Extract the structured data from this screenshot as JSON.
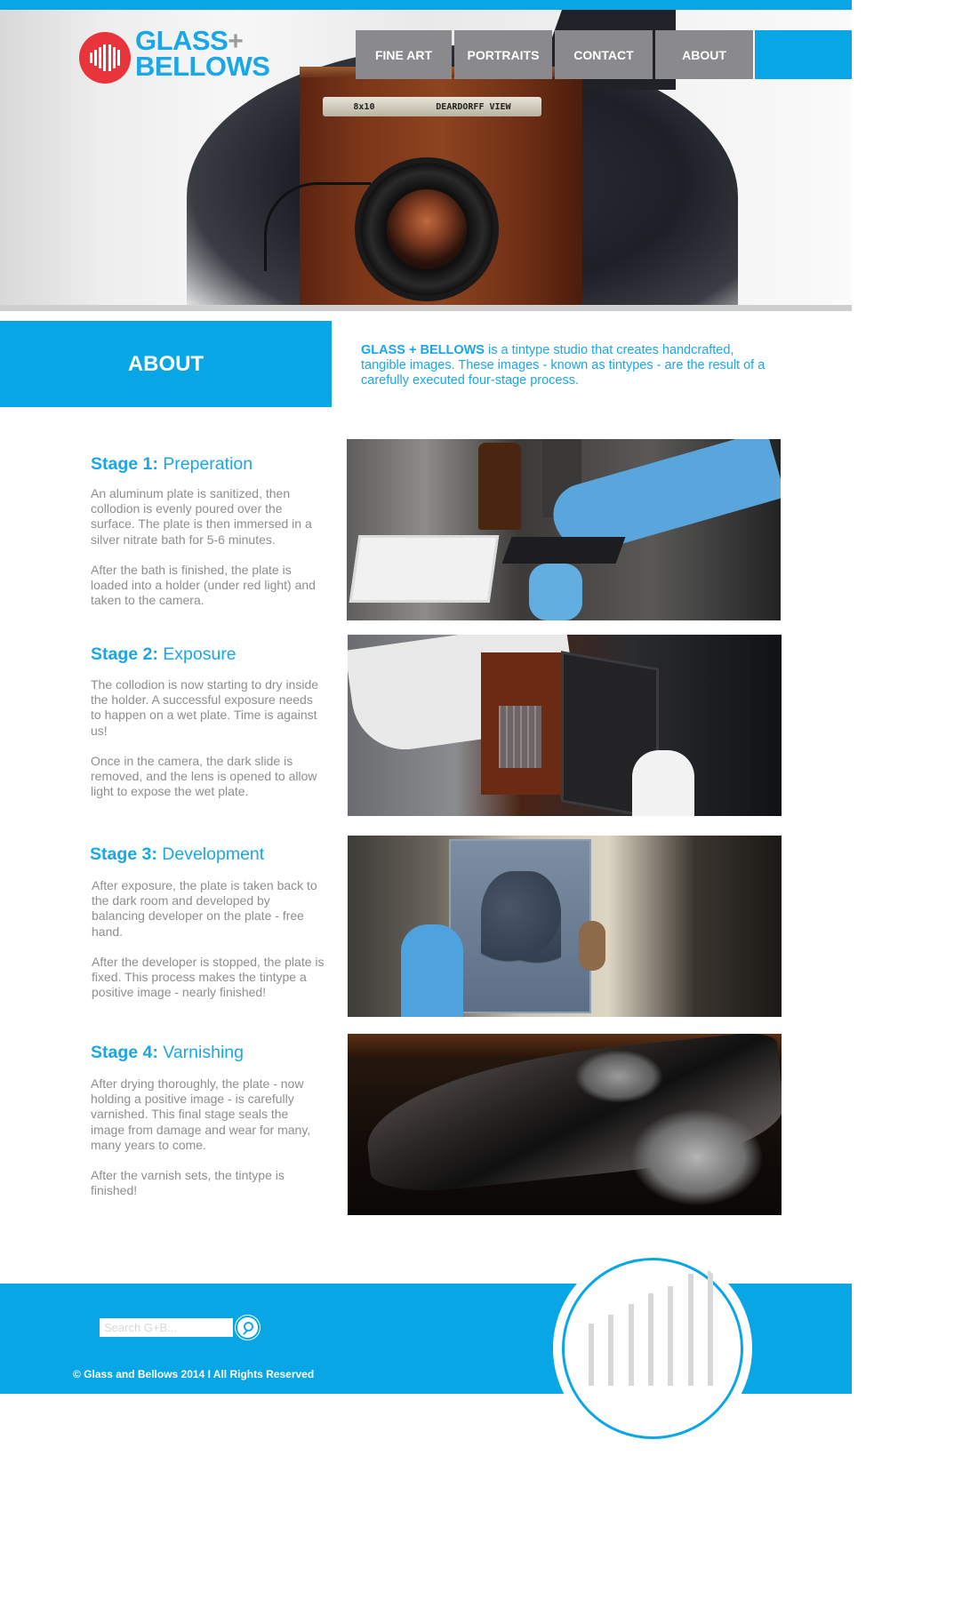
{
  "brand": {
    "name_line1": "GLASS",
    "plus": "+",
    "name_line2": "BELLOWS",
    "colors": {
      "accent": "#09a6e6",
      "logo_red": "#e8343a",
      "nav_gray": "#8a8a8c",
      "text_gray": "#8e8e8e"
    }
  },
  "nav": {
    "items": [
      {
        "label": "FINE ART"
      },
      {
        "label": "PORTRAITS"
      },
      {
        "label": "CONTACT"
      },
      {
        "label": "ABOUT"
      }
    ]
  },
  "hero": {
    "camera_plate_size": "8x10",
    "camera_plate_name": "DEARDORFF VIEW"
  },
  "about": {
    "heading": "ABOUT",
    "intro_brand": "GLASS + BELLOWS",
    "intro_text": " is a tintype studio that creates handcrafted, tangible images.  These images - known as tintypes - are the result of a carefully executed four-stage process."
  },
  "stages": [
    {
      "number_label": "Stage 1:",
      "name": " Preperation",
      "paragraphs": [
        "An aluminum plate is sanitized, then collodion is evenly poured over the surface. The plate is then immersed in a silver nitrate bath for 5-6 minutes.",
        "After the bath is finished, the plate is loaded into a holder (under red light) and taken to the camera."
      ]
    },
    {
      "number_label": "Stage 2:",
      "name": " Exposure",
      "paragraphs": [
        "The collodion is now starting to dry inside the holder. A successful exposure needs to happen on a wet plate. Time is against us!",
        "Once in the camera, the dark slide is removed, and the lens is opened to allow light to expose the wet plate."
      ]
    },
    {
      "number_label": "Stage 3:",
      "name": " Development",
      "paragraphs": [
        "After exposure, the plate is taken back to the dark room and developed by  balancing developer on the plate - free hand.",
        "After the developer is stopped, the plate is fixed. This process makes the tintype a positive image -  nearly finished!"
      ]
    },
    {
      "number_label": "Stage 4:",
      "name": " Varnishing",
      "paragraphs": [
        "After drying thoroughly, the plate - now holding a positive image - is carefully varnished. This final stage seals the image from damage and wear for many, many years to come.",
        "After the varnish sets, the tintype is finished!"
      ]
    }
  ],
  "footer": {
    "search_placeholder": "Search G+B...",
    "search_icon": "magnifier-icon",
    "copyright": "© Glass and Bellows 2014  I  All Rights Reserved"
  }
}
